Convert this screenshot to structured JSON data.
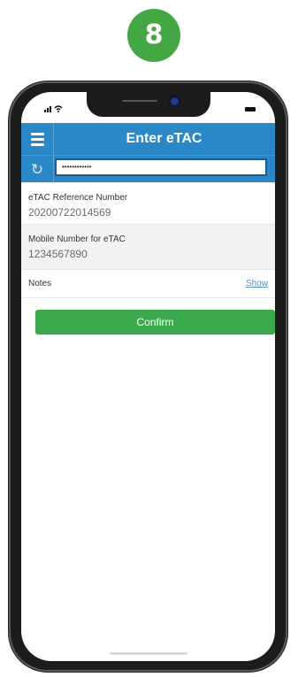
{
  "step_badge": "8",
  "status_bar": {
    "battery_icon": "battery-icon"
  },
  "header": {
    "title": "Enter eTAC",
    "menu_icon": "menu-icon"
  },
  "input": {
    "masked_value": "••••••••••••",
    "refresh_icon": "refresh-icon"
  },
  "fields": [
    {
      "label": "eTAC Reference Number",
      "value": "20200722014569"
    },
    {
      "label": "Mobile Number for eTAC",
      "value": "1234567890"
    }
  ],
  "notes": {
    "label": "Notes",
    "link": "Show"
  },
  "confirm_label": "Confirm",
  "colors": {
    "header": "#2b88c7",
    "confirm": "#3aa94c",
    "badge": "#43a843"
  }
}
